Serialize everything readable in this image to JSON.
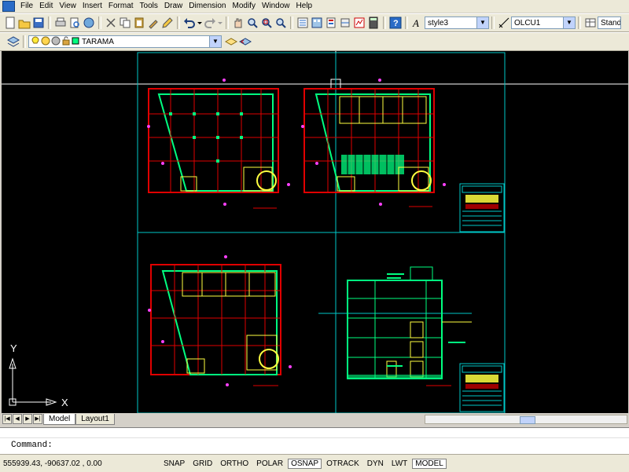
{
  "menu": [
    "File",
    "Edit",
    "View",
    "Insert",
    "Format",
    "Tools",
    "Draw",
    "Dimension",
    "Modify",
    "Window",
    "Help"
  ],
  "toolbar": {
    "text_style": "style3",
    "dim_style": "OLCU1",
    "table_style": "Stand"
  },
  "layers": {
    "current_layer": "TARAMA"
  },
  "tabs": {
    "model": "Model",
    "layout1": "Layout1"
  },
  "ucs": {
    "y": "Y",
    "x": "X"
  },
  "command": {
    "prompt": "Command:"
  },
  "status": {
    "coords": "555939.43, -90637.02 , 0.00",
    "buttons": [
      "SNAP",
      "GRID",
      "ORTHO",
      "POLAR",
      "OSNAP",
      "OTRACK",
      "DYN",
      "LWT",
      "MODEL"
    ]
  },
  "colors": {
    "viewport": "#00c8c8",
    "walls": "#e00000",
    "lines": "#ffff40",
    "fill": "#00ff80",
    "accent": "#ff40ff"
  }
}
